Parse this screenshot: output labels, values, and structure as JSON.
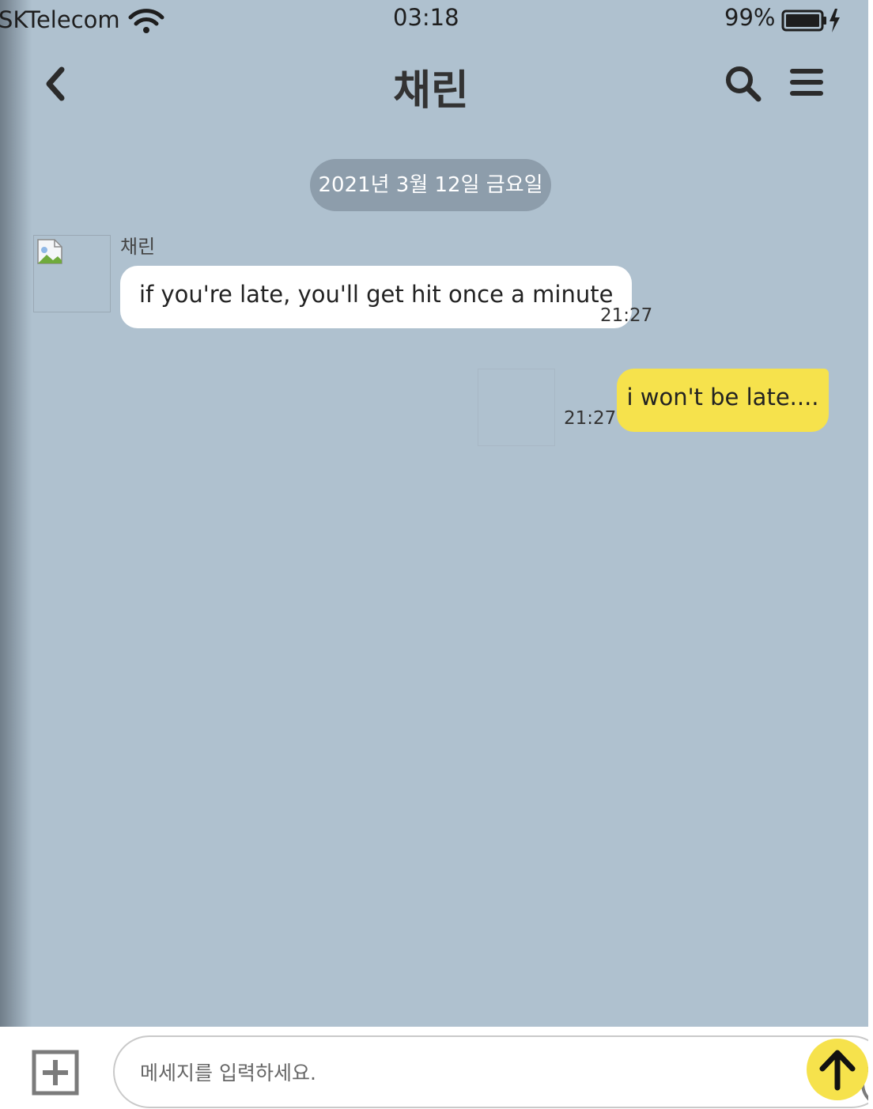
{
  "status_bar": {
    "carrier": "SKTelecom",
    "time": "03:18",
    "battery": "99%",
    "icons": [
      "wifi-icon",
      "battery-icon",
      "charging-bolt-icon"
    ]
  },
  "header": {
    "title": "채린",
    "icons": [
      "chevron-left-icon",
      "search-icon",
      "hamburger-menu-icon"
    ]
  },
  "date_divider": "2021년 3월 12일 금요일",
  "messages": [
    {
      "direction": "incoming",
      "sender": "채린",
      "text": "if you're late, you'll get hit once a minute",
      "time": "21:27"
    },
    {
      "direction": "outgoing",
      "text": "i won't be late....",
      "time": "21:27"
    }
  ],
  "composer": {
    "placeholder": "메세지를 입력하세요.",
    "icons": [
      "plus-box-icon",
      "smiley-icon",
      "arrow-up-icon"
    ]
  },
  "colors": {
    "chat_background": "#AFC1CF",
    "outgoing_bubble": "#F6E24C",
    "incoming_bubble": "#FFFFFF",
    "date_pill": "#8D9DAB",
    "send_button": "#F6E24C"
  }
}
